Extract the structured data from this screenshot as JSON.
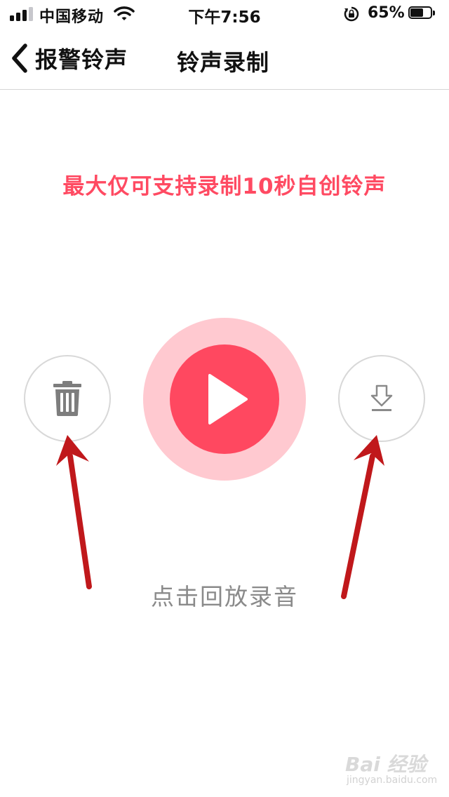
{
  "status_bar": {
    "carrier": "中国移动",
    "time": "下午7:56",
    "battery_percent": "65%",
    "battery_level": 0.65,
    "signal_bars": 3,
    "icons": [
      "signal-icon",
      "wifi-icon",
      "rotation-lock-icon",
      "battery-icon"
    ]
  },
  "nav": {
    "back_label": "报警铃声",
    "title": "铃声录制",
    "icons": [
      "chevron-left-icon"
    ]
  },
  "recorder": {
    "hint": "最大仅可支持录制10秒自创铃声",
    "playback_label": "点击回放录音",
    "icons": [
      "trash-icon",
      "play-icon",
      "download-icon"
    ]
  },
  "colors": {
    "accent": "#ff4860",
    "accent_light": "#ffc9d0",
    "hint_text": "#ff4a62",
    "annotation_arrow": "#c0181b"
  },
  "watermark": {
    "brand": "Bai 经验",
    "url": "jingyan.baidu.com"
  }
}
